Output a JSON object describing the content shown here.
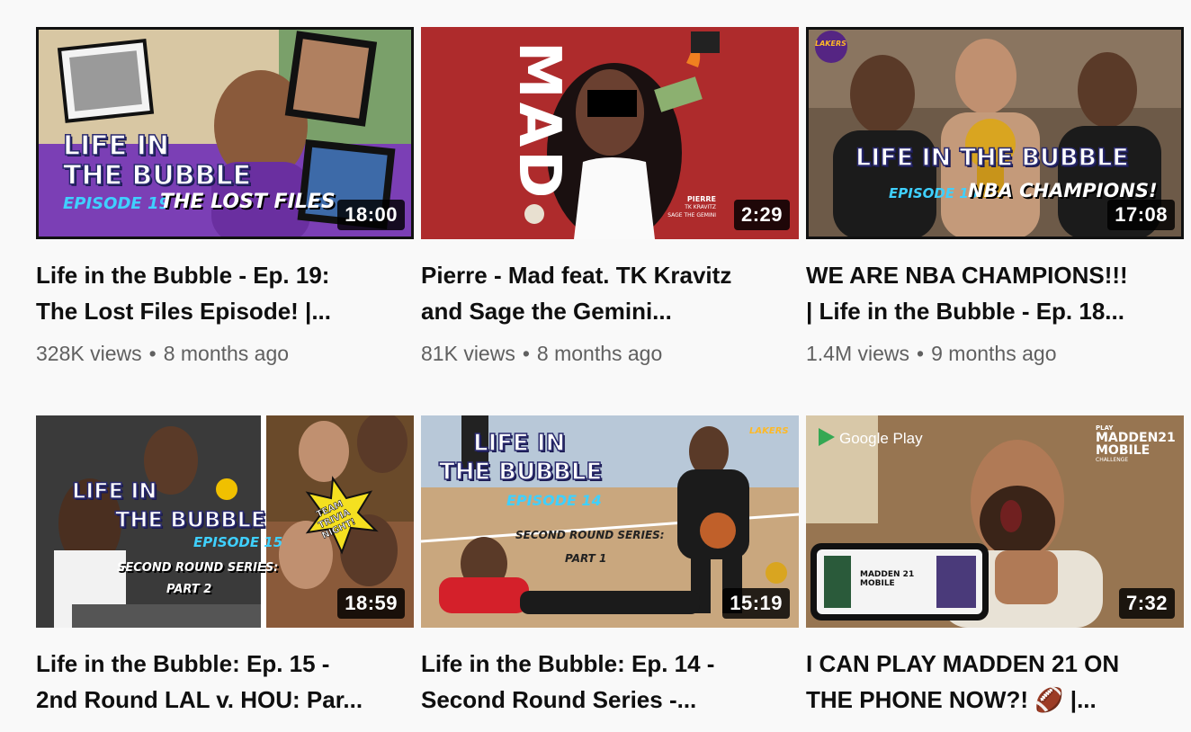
{
  "videos": [
    {
      "duration": "18:00",
      "title_l1": "Life in the Bubble - Ep. 19:",
      "title_l2": "The Lost Files Episode! |...",
      "views": "328K views",
      "age": "8 months ago",
      "thumb_text": {
        "t1": "LIFE IN",
        "t2": "THE BUBBLE",
        "ep": "EPISODE 19",
        "sub": "THE LOST FILES"
      }
    },
    {
      "duration": "2:29",
      "title_l1": "Pierre - Mad feat. TK Kravitz",
      "title_l2": "and Sage the Gemini...",
      "views": "81K views",
      "age": "8 months ago",
      "thumb_text": {
        "big": "MAD",
        "credit1": "PIERRE",
        "credit2": "TK KRAVITZ",
        "credit3": "SAGE THE GEMINI"
      }
    },
    {
      "duration": "17:08",
      "title_l1": "WE ARE NBA CHAMPIONS!!!",
      "title_l2": "| Life in the Bubble - Ep. 18...",
      "views": "1.4M views",
      "age": "9 months ago",
      "thumb_text": {
        "t1": "LIFE IN THE BUBBLE",
        "ep": "EPISODE 18",
        "sub": "NBA CHAMPIONS!",
        "logo": "LAKERS"
      }
    },
    {
      "duration": "18:59",
      "title_l1": "Life in the Bubble: Ep. 15 -",
      "title_l2": "2nd Round LAL v. HOU: Par...",
      "views": "",
      "age": "",
      "thumb_text": {
        "t1": "LIFE IN",
        "t2": "THE BUBBLE",
        "ep": "EPISODE 15",
        "sub1": "SECOND ROUND SERIES:",
        "sub2": "PART 2",
        "burst": "TEAM TRIVIA NIGHT!"
      }
    },
    {
      "duration": "15:19",
      "title_l1": "Life in the Bubble: Ep. 14 -",
      "title_l2": "Second Round Series -...",
      "views": "",
      "age": "",
      "thumb_text": {
        "t1": "LIFE IN",
        "t2": "THE BUBBLE",
        "ep": "EPISODE 14",
        "sub1": "SECOND ROUND SERIES:",
        "sub2": "PART 1",
        "logo": "LAKERS"
      }
    },
    {
      "duration": "7:32",
      "title_l1": "I CAN PLAY MADDEN 21 ON",
      "title_l2": "THE PHONE NOW?! 🏈  |...",
      "views": "",
      "age": "",
      "thumb_text": {
        "gp": "Google Play",
        "m1": "PLAY",
        "m2": "MADDEN21",
        "m3": "MOBILE",
        "m4": "CHALLENGE",
        "phone": "MADDEN 21 MOBILE"
      }
    }
  ],
  "separator": "•"
}
